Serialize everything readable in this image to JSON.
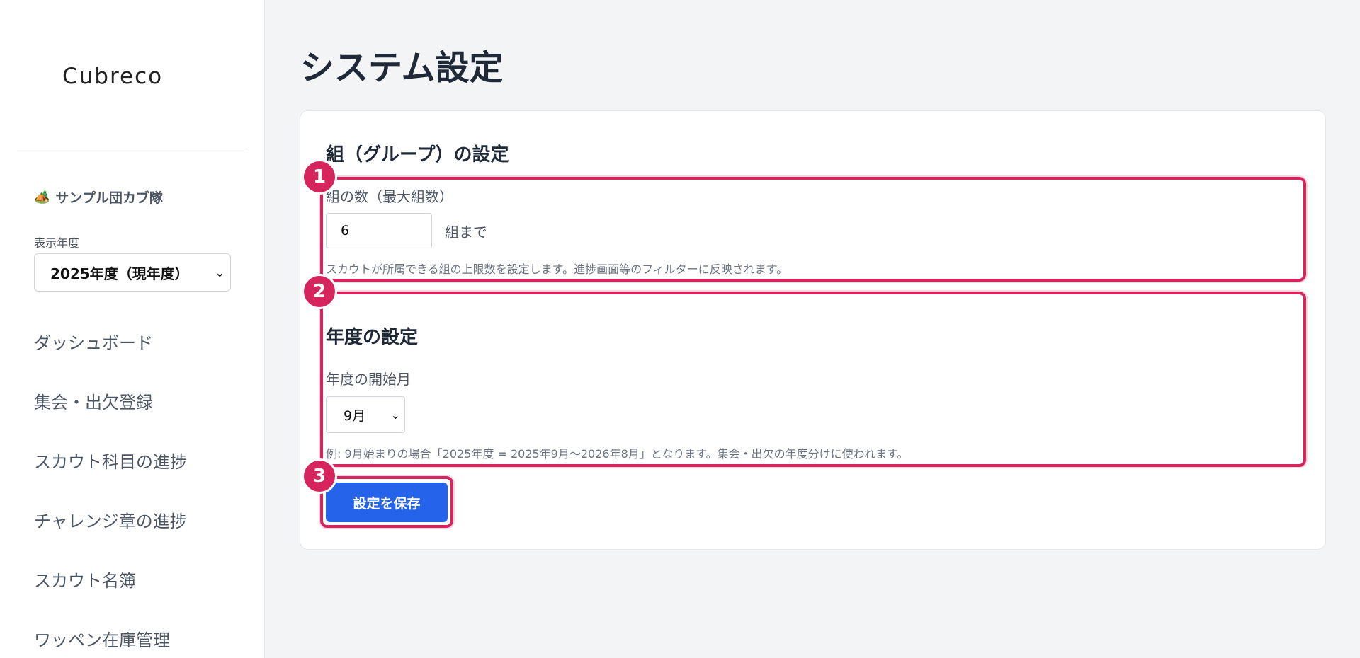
{
  "sidebar": {
    "logo": "Cubreco",
    "troop_icon": "🏕️",
    "troop_name": "サンプル団カブ隊",
    "year_label": "表示年度",
    "year_selected": "2025年度（現年度）",
    "nav": [
      "ダッシュボード",
      "集会・出欠登録",
      "スカウト科目の進捗",
      "チャレンジ章の進捗",
      "スカウト名簿",
      "ワッペン在庫管理"
    ]
  },
  "main": {
    "page_title": "システム設定",
    "group_section": {
      "title": "組（グループ）の設定",
      "field_label": "組の数（最大組数）",
      "value": "6",
      "suffix": "組まで",
      "help": "スカウトが所属できる組の上限数を設定します。進捗画面等のフィルターに反映されます。"
    },
    "year_section": {
      "title": "年度の設定",
      "field_label": "年度の開始月",
      "selected_month": "9月",
      "help": "例: 9月始まりの場合「2025年度 = 2025年9月〜2026年8月」となります。集会・出欠の年度分けに使われます。"
    },
    "save_label": "設定を保存"
  },
  "annotations": [
    "1",
    "2",
    "3"
  ],
  "colors": {
    "accent": "#2563eb",
    "highlight": "#d6245c"
  }
}
